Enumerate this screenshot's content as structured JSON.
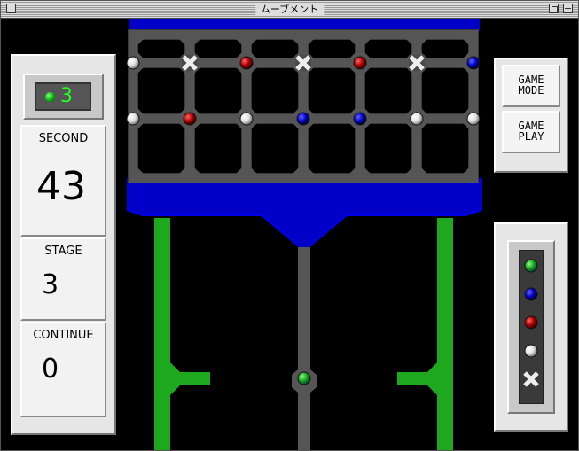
{
  "window": {
    "title": "ムーブメント"
  },
  "left_panel": {
    "remaining": "3",
    "second": {
      "label": "SECOND",
      "value": "43"
    },
    "stage": {
      "label": "STAGE",
      "value": "3"
    },
    "continue": {
      "label": "CONTINUE",
      "value": "0"
    }
  },
  "buttons": {
    "game_mode": [
      "GAME",
      "MODE"
    ],
    "game_play": [
      "GAME",
      "PLAY"
    ]
  },
  "colors": {
    "green": "#1ea81e",
    "blue": "#0000c8",
    "red": "#b00000",
    "white": "#e0e0e0",
    "pipe": "#555555"
  },
  "board": {
    "rows": [
      [
        "white",
        "x",
        "red",
        "x",
        "red",
        "x",
        "blue"
      ],
      [
        "white",
        "red",
        "white",
        "blue",
        "blue",
        "white",
        "white"
      ]
    ],
    "launcher": "green"
  },
  "legend": [
    "green",
    "blue",
    "red",
    "white",
    "x"
  ]
}
